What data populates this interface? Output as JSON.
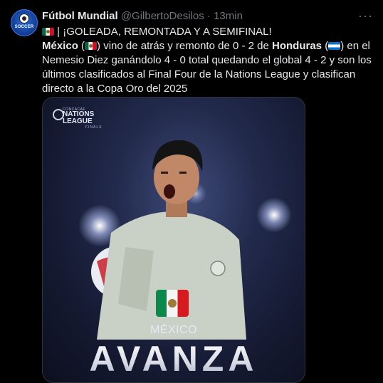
{
  "author": {
    "name": "Fútbol Mundial",
    "handle": "@GilbertoDesilos",
    "separator": "·",
    "time": "13min",
    "avatar_text": "SOCCER",
    "more_label": "···"
  },
  "tweet": {
    "line1": "| ¡GOLEADA, REMONTADA Y A SEMIFINAL!",
    "team1": "México",
    "paren_open": "(",
    "paren_close": ")",
    "text1": " vino de atrás y remonto de 0 - 2 de ",
    "team2": "Honduras",
    "text2": " en el Nemesio Diez ganándolo 4 - 0 total quedando el global 4 - 2 y son los últimos clasificados al Final Four de la Nations League y clasifican directo a la Copa Oro del 2025"
  },
  "media": {
    "logo_small": "CONCACAF",
    "logo_line1": "NATIONS",
    "logo_line2": "LEAGUE",
    "logo_sub": "FINALS",
    "country": "MÉXICO",
    "headline": "AVANZA"
  },
  "colors": {
    "background": "#000000",
    "text": "#e7e9ea",
    "muted": "#71767b",
    "mexico_green": "#006847",
    "mexico_red": "#ce1126",
    "honduras_blue": "#0073cf"
  },
  "icons": [
    "more-icon",
    "mexico-flag-icon",
    "honduras-flag-icon"
  ]
}
